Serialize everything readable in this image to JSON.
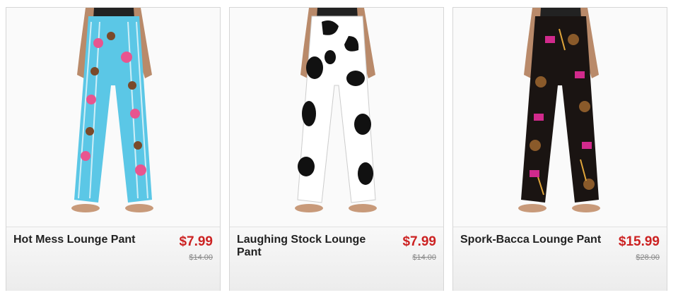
{
  "products": [
    {
      "name": "Hot Mess Lounge Pant",
      "price": "$7.99",
      "was_price": "$14.00",
      "image": "pajama-pants-icecream-print-photo",
      "colors": {
        "base": "#5bc7e6",
        "accent": "#e8558f",
        "stripe": "#ffffff"
      }
    },
    {
      "name": "Laughing Stock Lounge Pant",
      "price": "$7.99",
      "was_price": "$14.00",
      "image": "pajama-pants-cow-print-photo",
      "colors": {
        "base": "#ffffff",
        "accent": "#111111",
        "stripe": "#111111"
      }
    },
    {
      "name": "Spork-Bacca Lounge Pant",
      "price": "$15.99",
      "was_price": "$28.00",
      "image": "pajama-pants-dark-print-photo",
      "colors": {
        "base": "#1a1412",
        "accent": "#d12a8c",
        "stripe": "#e0a53a"
      }
    }
  ],
  "theme": {
    "price_color": "#cc2222",
    "was_color": "#888888"
  }
}
